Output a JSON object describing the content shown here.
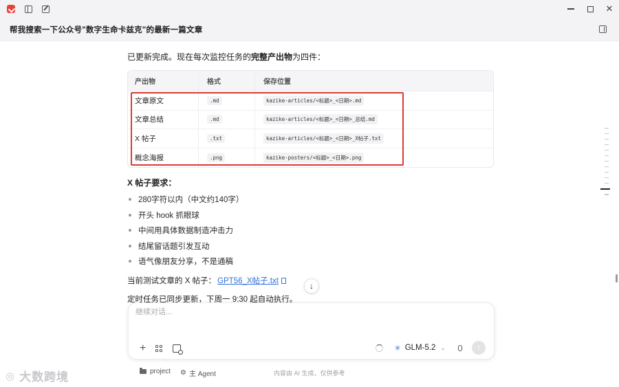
{
  "window": {
    "minimize_icon": "minimize-icon",
    "maximize_icon": "maximize-icon",
    "close_label": "✕"
  },
  "header": {
    "chat_title": "帮我搜索一下公众号\"数字生命卡兹克\"的最新一篇文章"
  },
  "message": {
    "intro_prefix": "已更新完成。现在每次监控任务的",
    "intro_bold": "完整产出物",
    "intro_suffix": "为四件：",
    "table": {
      "headers": [
        "产出物",
        "格式",
        "保存位置"
      ],
      "rows": [
        {
          "name": "文章原文",
          "format": ".md",
          "path": "kazike-articles/<标题>_<日期>.md"
        },
        {
          "name": "文章总结",
          "format": ".md",
          "path": "kazike-articles/<标题>_<日期>_总结.md"
        },
        {
          "name": "X 帖子",
          "format": ".txt",
          "path": "kazike-articles/<标题>_<日期>_X帖子.txt"
        },
        {
          "name": "概念海报",
          "format": ".png",
          "path": "kazike-posters/<标题>_<日期>.png"
        }
      ]
    },
    "section_title": "X 帖子要求：",
    "bullets": [
      "280字符以内（中文约140字）",
      "开头 hook 抓眼球",
      "中间用具体数据制造冲击力",
      "结尾留话题引发互动",
      "语气像朋友分享，不是通稿"
    ],
    "file_prefix": "当前测试文章的 X 帖子：",
    "file_link": "GPT56_X帖子.txt",
    "schedule": "定时任务已同步更新，下周一 9:30 起自动执行。"
  },
  "composer": {
    "placeholder": "继续对话...",
    "value": "",
    "model": "GLM-5.2"
  },
  "footer": {
    "project": "project",
    "agent": "主 Agent",
    "disclaimer": "内容由 AI 生成，仅供参考"
  },
  "watermark": {
    "text": "大数跨境"
  },
  "colors": {
    "highlight": "#d93a31",
    "link": "#2f6fd8",
    "accent_logo": "#e9413a"
  }
}
